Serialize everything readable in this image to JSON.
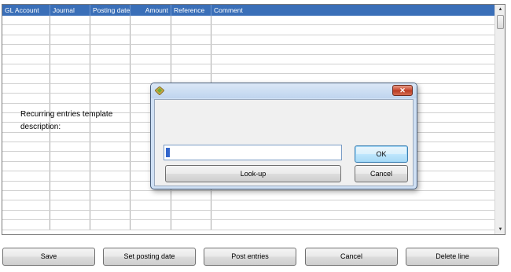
{
  "grid": {
    "columns": [
      {
        "label": "GL Account",
        "align": "left"
      },
      {
        "label": "Journal",
        "align": "left"
      },
      {
        "label": "Posting date",
        "align": "left"
      },
      {
        "label": "Amount",
        "align": "right"
      },
      {
        "label": "Reference",
        "align": "left"
      },
      {
        "label": "Comment",
        "align": "left"
      }
    ],
    "row_count": 22,
    "header_color": "#3a6fb8"
  },
  "buttons": {
    "save": "Save",
    "set_posting_date": "Set posting date",
    "post_entries": "Post entries",
    "cancel": "Cancel",
    "delete_line": "Delete line"
  },
  "dialog": {
    "title": "",
    "prompt_line1": "Recurring entries template",
    "prompt_line2": "description:",
    "input_value": "",
    "ok": "OK",
    "cancel": "Cancel",
    "lookup": "Look-up",
    "close_glyph": "✕"
  }
}
